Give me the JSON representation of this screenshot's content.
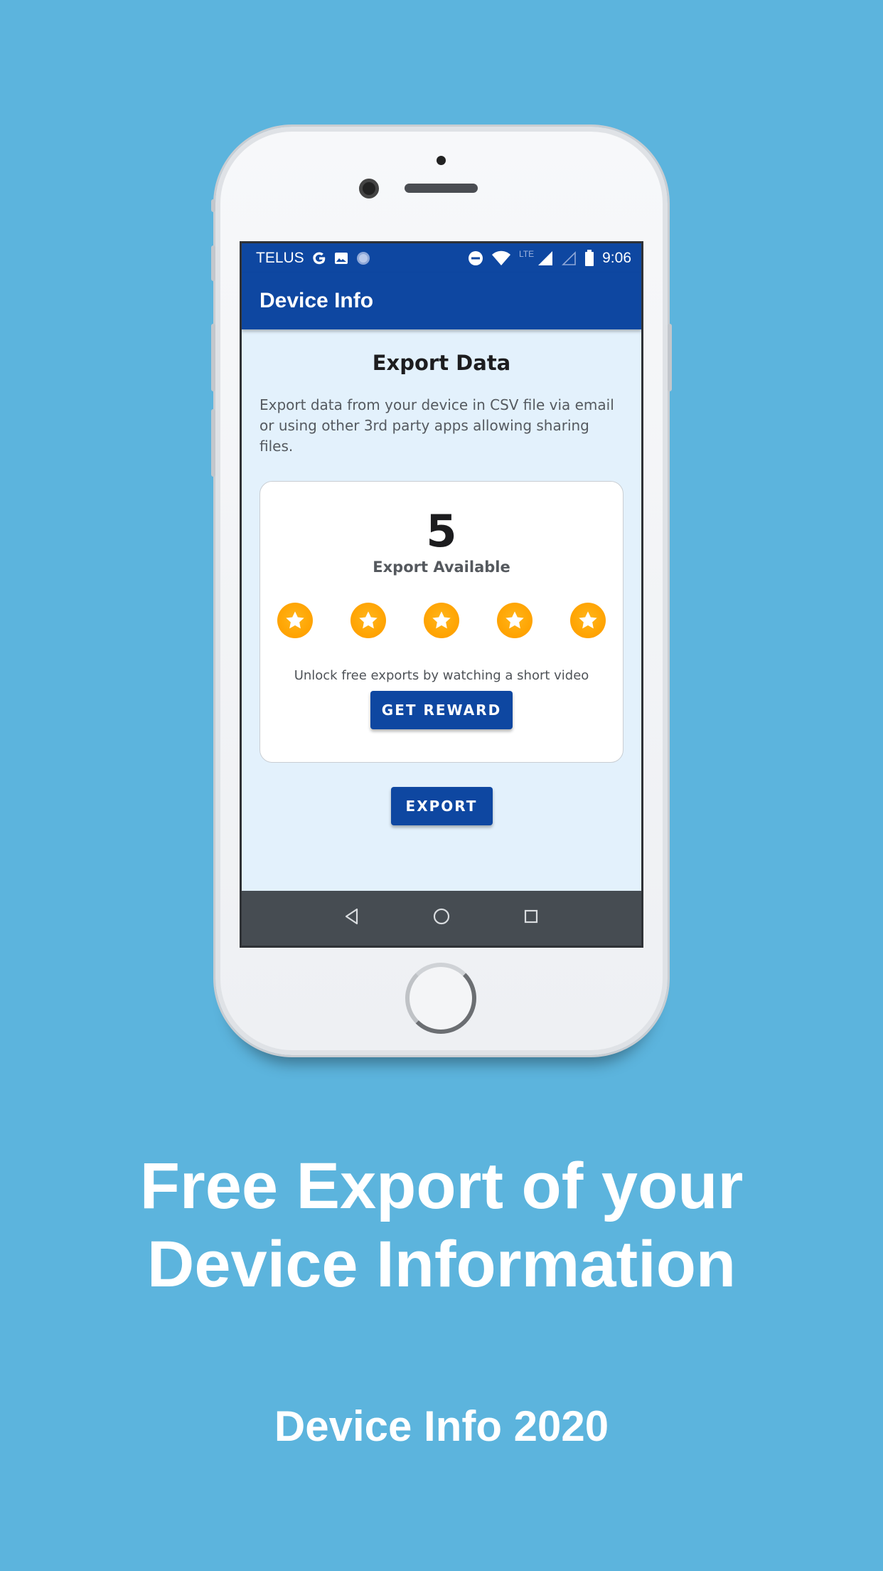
{
  "status_bar": {
    "carrier": "TELUS",
    "network_label": "LTE",
    "time": "9:06"
  },
  "app_bar": {
    "title": "Device Info"
  },
  "export": {
    "title": "Export Data",
    "description": "Export data from your device in CSV file via email or using other 3rd party apps allowing sharing files.",
    "available_count": "5",
    "available_label": "Export Available",
    "rewards_total": 5,
    "unlock_text": "Unlock free exports by watching a short video",
    "reward_button": "GET REWARD",
    "export_button": "EXPORT"
  },
  "nav_bar": {
    "icons": [
      "back-icon",
      "home-icon",
      "recents-icon"
    ]
  },
  "promo": {
    "headline_line1": "Free Export of your",
    "headline_line2": "Device Information",
    "subheadline": "Device Info 2020"
  },
  "colors": {
    "background": "#5cb4dd",
    "primary": "#0e47a1",
    "screen_bg": "#e3f1fc",
    "star": "#ffa200",
    "nav_bar": "#464c52"
  }
}
